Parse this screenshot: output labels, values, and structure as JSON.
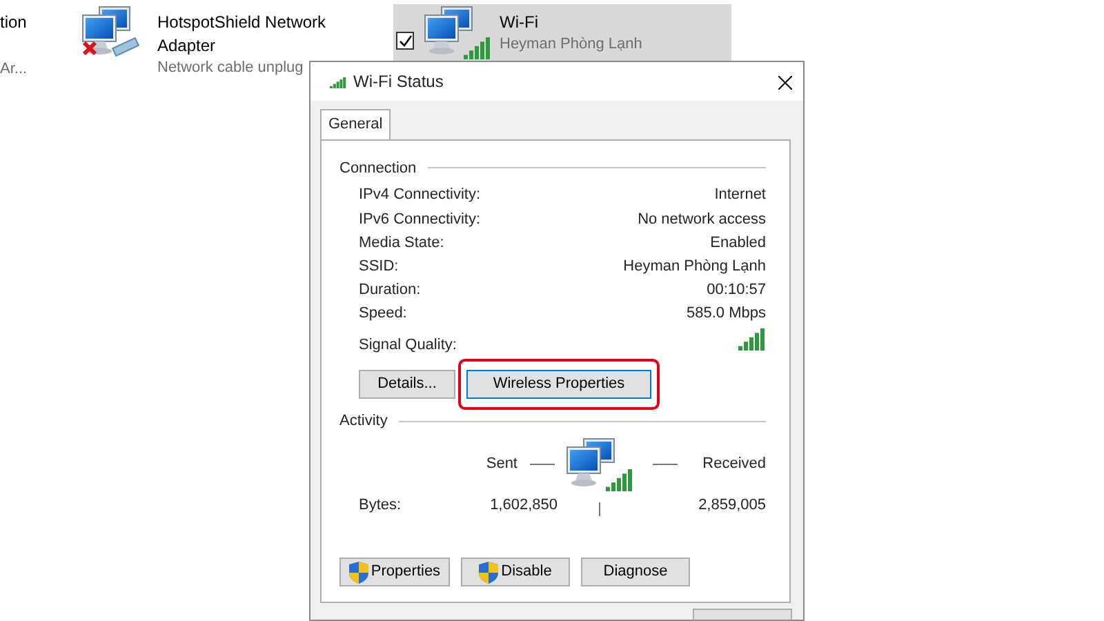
{
  "connections": [
    {
      "kind": "partial",
      "name": "tion",
      "status": "Ar...",
      "selected": false
    },
    {
      "kind": "ethernet",
      "name": "HotspotShield Network Adapter",
      "status": "Network cable unplug",
      "selected": false,
      "disconnected": true
    },
    {
      "kind": "wifi",
      "name": "Wi-Fi",
      "status": "Heyman Phòng Lạnh",
      "selected": true,
      "checked": true
    }
  ],
  "dialog": {
    "title": "Wi-Fi Status",
    "tabs": [
      {
        "label": "General",
        "selected": true
      }
    ],
    "connection": {
      "heading": "Connection",
      "rows": [
        {
          "label": "IPv4 Connectivity:",
          "value": "Internet"
        },
        {
          "label": "IPv6 Connectivity:",
          "value": "No network access"
        },
        {
          "label": "Media State:",
          "value": "Enabled"
        },
        {
          "label": "SSID:",
          "value": "Heyman Phòng Lạnh"
        },
        {
          "label": "Duration:",
          "value": "00:10:57"
        },
        {
          "label": "Speed:",
          "value": "585.0 Mbps"
        }
      ],
      "signal_label": "Signal Quality:",
      "buttons": [
        {
          "label": "Details...",
          "highlighted": false
        },
        {
          "label": "Wireless Properties",
          "highlighted": true
        }
      ]
    },
    "activity": {
      "heading": "Activity",
      "sent_label": "Sent",
      "received_label": "Received",
      "bytes_label": "Bytes:",
      "sent": "1,602,850",
      "received": "2,859,005",
      "buttons": [
        {
          "label": "Properties",
          "shield": true
        },
        {
          "label": "Disable",
          "shield": true
        },
        {
          "label": "Diagnose",
          "shield": false
        }
      ]
    }
  }
}
